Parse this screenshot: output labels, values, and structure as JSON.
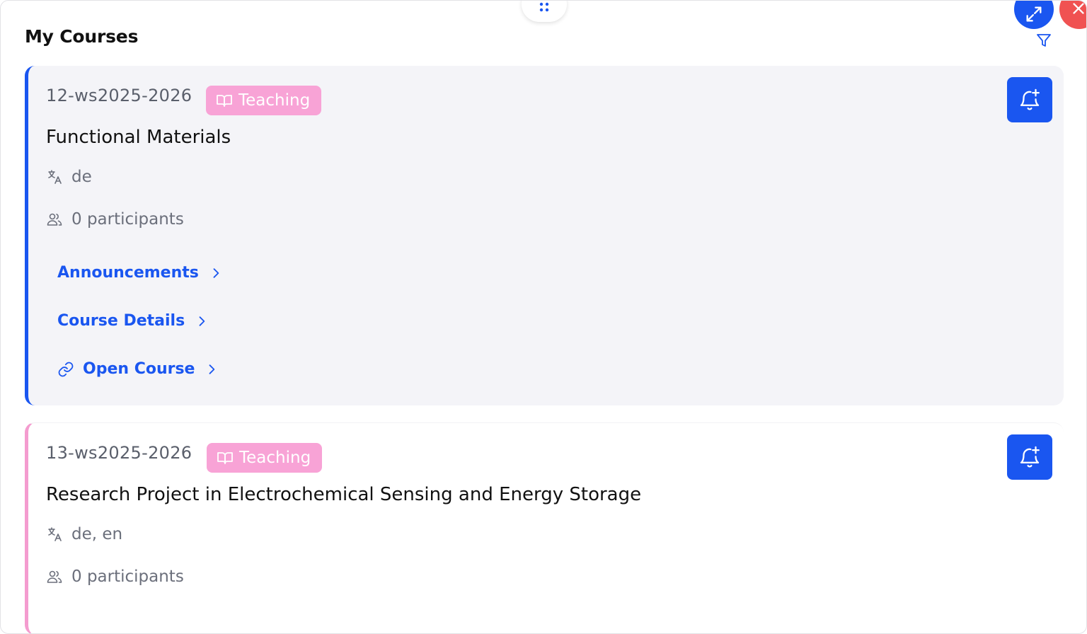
{
  "panel": {
    "title": "My Courses"
  },
  "controls": {
    "drag_icon": "drag-dots-icon",
    "expand_icon": "expand-icon",
    "close_icon": "close-icon",
    "filter_icon": "filter-icon"
  },
  "colors": {
    "accent": "#1a56f0",
    "teaching_badge": "#f8a3d6",
    "close": "#f05252"
  },
  "courses": [
    {
      "code": "12-ws2025-2026",
      "badge": "Teaching",
      "name": "Functional Materials",
      "languages": "de",
      "participants": "0 participants",
      "links": {
        "announcements": "Announcements",
        "details": "Course Details",
        "open": "Open Course"
      }
    },
    {
      "code": "13-ws2025-2026",
      "badge": "Teaching",
      "name": "Research Project in Electrochemical Sensing and Energy Storage",
      "languages": "de, en",
      "participants": "0 participants"
    }
  ]
}
